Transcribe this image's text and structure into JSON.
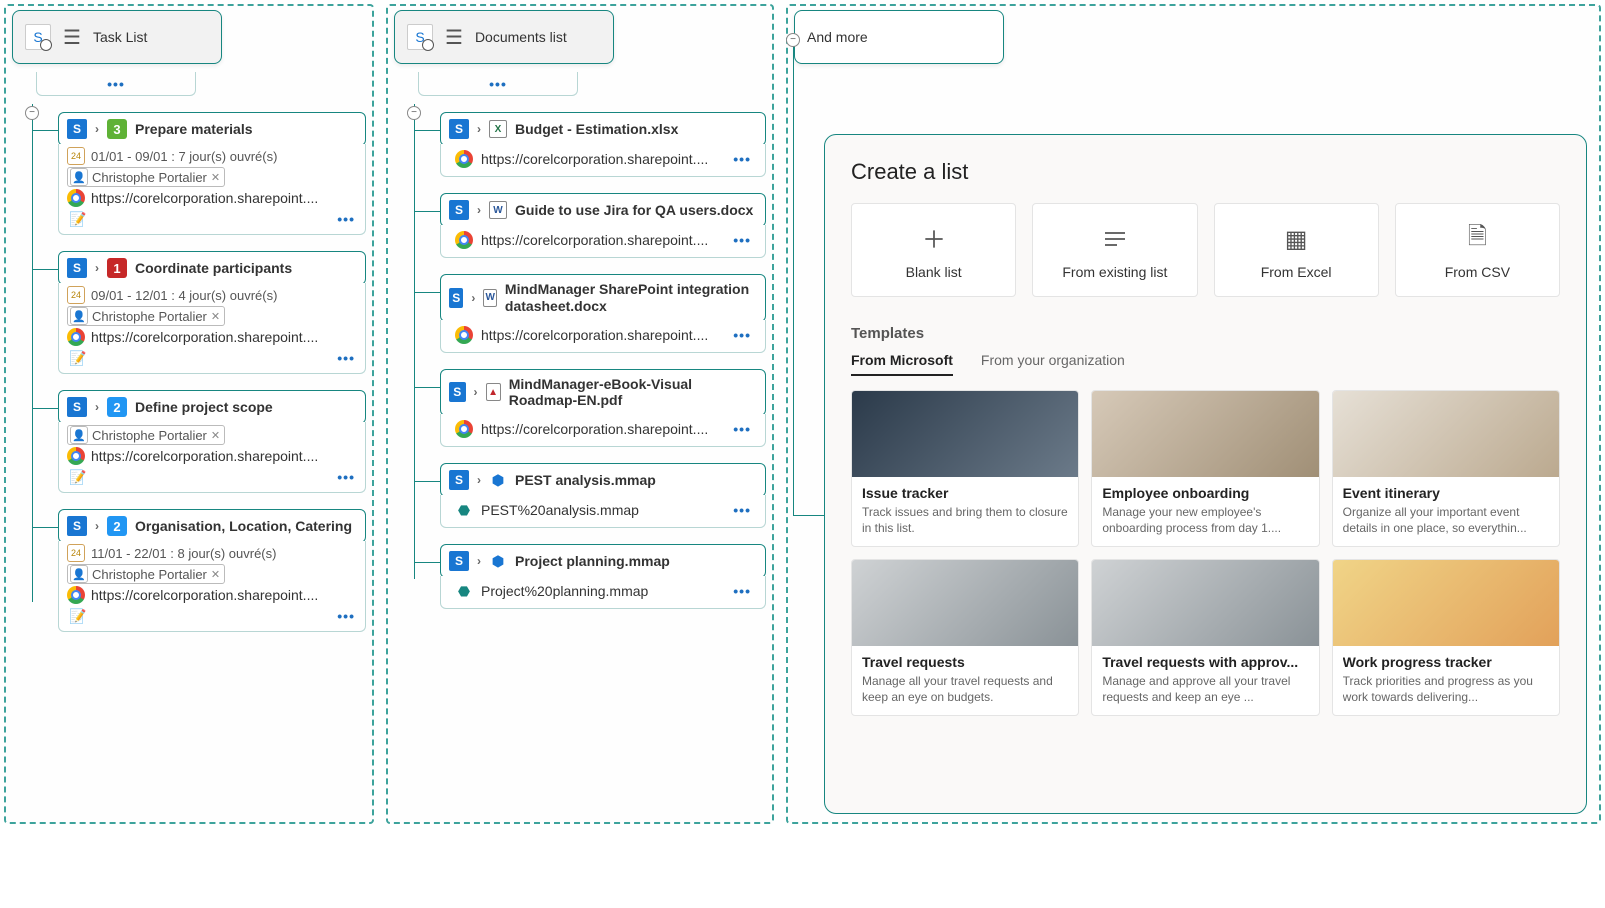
{
  "columns": {
    "task_list": {
      "title": "Task List",
      "nodes": [
        {
          "priority": "3",
          "prio_class": "p3",
          "title": "Prepare materials",
          "date": "01/01 - 09/01 : 7 jour(s) ouvré(s)",
          "assignee": "Christophe Portalier",
          "link": "https://corelcorporation.sharepoint...."
        },
        {
          "priority": "1",
          "prio_class": "p1",
          "title": "Coordinate participants",
          "date": "09/01 - 12/01 : 4 jour(s) ouvré(s)",
          "assignee": "Christophe Portalier",
          "link": "https://corelcorporation.sharepoint...."
        },
        {
          "priority": "2",
          "prio_class": "p2",
          "title": "Define project scope",
          "date": "",
          "assignee": "Christophe Portalier",
          "link": "https://corelcorporation.sharepoint...."
        },
        {
          "priority": "2",
          "prio_class": "p2",
          "title": "Organisation, Location, Catering",
          "date": "11/01 - 22/01 : 8 jour(s) ouvré(s)",
          "assignee": "Christophe Portalier",
          "link": "https://corelcorporation.sharepoint...."
        }
      ]
    },
    "documents_list": {
      "title": "Documents list",
      "docs": [
        {
          "icon": "xlsx",
          "glyph": "X",
          "title": "Budget - Estimation.xlsx",
          "link": "https://corelcorporation.sharepoint...."
        },
        {
          "icon": "docx",
          "glyph": "W",
          "title": "Guide to use Jira for QA users.docx",
          "link": "https://corelcorporation.sharepoint...."
        },
        {
          "icon": "docx",
          "glyph": "W",
          "title": "MindManager SharePoint integration datasheet.docx",
          "link": "https://corelcorporation.sharepoint...."
        },
        {
          "icon": "pdf",
          "glyph": "▲",
          "title": "MindManager-eBook-Visual Roadmap-EN.pdf",
          "link": "https://corelcorporation.sharepoint...."
        },
        {
          "icon": "mm",
          "glyph": "⬢",
          "title": "PEST analysis.mmap",
          "mm_link": "PEST%20analysis.mmap"
        },
        {
          "icon": "mm",
          "glyph": "⬢",
          "title": "Project planning.mmap",
          "mm_link": "Project%20planning.mmap"
        }
      ]
    },
    "more": {
      "title": "And more",
      "panel": {
        "heading": "Create a list",
        "options": [
          {
            "label": "Blank list",
            "icon": "plus"
          },
          {
            "label": "From existing list",
            "icon": "lines"
          },
          {
            "label": "From Excel",
            "icon": "excel"
          },
          {
            "label": "From CSV",
            "icon": "csv"
          }
        ],
        "templates_label": "Templates",
        "tabs": {
          "active": "From Microsoft",
          "other": "From your organization"
        },
        "templates": [
          {
            "title": "Issue tracker",
            "desc": "Track issues and bring them to closure in this list.",
            "img": "img1"
          },
          {
            "title": "Employee onboarding",
            "desc": "Manage your new employee's onboarding process from day 1....",
            "img": "img2"
          },
          {
            "title": "Event itinerary",
            "desc": "Organize all your important event details in one place, so everythin...",
            "img": "img3"
          },
          {
            "title": "Travel requests",
            "desc": "Manage all your travel requests and keep an eye on budgets.",
            "img": "img4"
          },
          {
            "title": "Travel requests with approv...",
            "desc": "Manage and approve all your travel requests and keep an eye ...",
            "img": "img5"
          },
          {
            "title": "Work progress tracker",
            "desc": "Track priorities and progress as you work towards delivering...",
            "img": "img6"
          }
        ]
      }
    }
  }
}
